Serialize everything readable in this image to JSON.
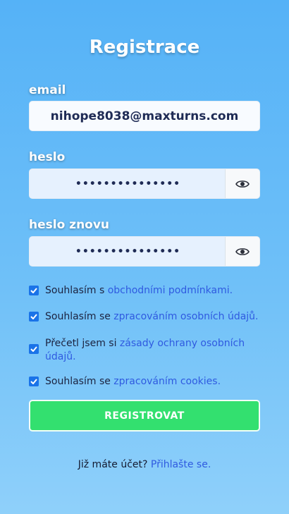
{
  "title": "Registrace",
  "email": {
    "label": "email",
    "value": "nihope8038@maxturns.com"
  },
  "password": {
    "label": "heslo",
    "value": "•••••••••••••••"
  },
  "password_repeat": {
    "label": "heslo znovu",
    "value": "•••••••••••••••"
  },
  "consents": [
    {
      "prefix": "Souhlasím s ",
      "link": "obchodními podmínkami.",
      "checked": true
    },
    {
      "prefix": "Souhlasím se ",
      "link": "zpracováním osobních údajů.",
      "checked": true
    },
    {
      "prefix": "Přečetl jsem si ",
      "link": "zásady ochrany osobních údajů.",
      "checked": true
    },
    {
      "prefix": "Souhlasím se ",
      "link": "zpracováním cookies.",
      "checked": true
    }
  ],
  "submit_label": "REGISTROVAT",
  "footer": {
    "text": "Již máte účet? ",
    "link": "Přihlašte se."
  },
  "colors": {
    "submit": "#33e06f",
    "link": "#2f5ae0",
    "checkbox": "#1a73e8"
  },
  "icons": {
    "eye": "eye-icon",
    "check": "checkmark-icon"
  }
}
